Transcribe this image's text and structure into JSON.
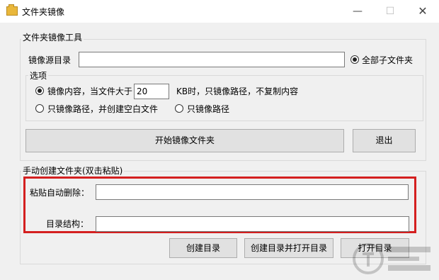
{
  "window": {
    "title": "文件夹镜像",
    "minimize": "—",
    "maximize": "☐",
    "close": "✕"
  },
  "mirror_tool": {
    "legend": "文件夹镜像工具",
    "source_label": "镜像源目录",
    "source_value": "",
    "all_subfolders_label": "全部子文件夹",
    "all_subfolders_selected": true,
    "options": {
      "legend": "选项",
      "opt1_label_before": "镜像内容，当文件大于",
      "size_value": "20",
      "opt1_label_after": "KB时，只镜像路径，不复制内容",
      "opt1_selected": true,
      "opt2_label": "只镜像路径，并创建空白文件",
      "opt2_selected": false,
      "opt3_label": "只镜像路径",
      "opt3_selected": false
    },
    "start_button": "开始镜像文件夹",
    "exit_button": "退出"
  },
  "manual": {
    "legend": "手动创建文件夹(双击粘贴)",
    "paste_label": "粘贴自动删除：",
    "paste_value": "",
    "structure_label": "目录结构：",
    "structure_value": "",
    "create_button": "创建目录",
    "create_open_button": "创建目录并打开目录",
    "open_button": "打开目录"
  },
  "colors": {
    "highlight": "#d41f1f",
    "background": "#f0f0f0"
  }
}
